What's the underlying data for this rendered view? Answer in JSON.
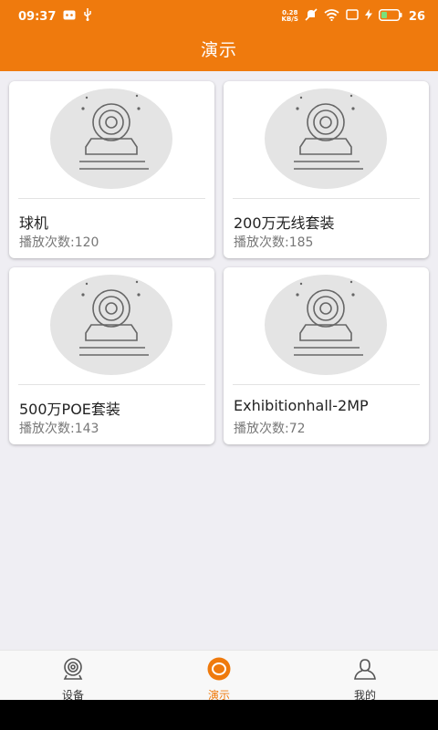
{
  "status_bar": {
    "time": "09:37",
    "net_speed_value": "0.28",
    "net_speed_unit": "KB/S",
    "battery": "26"
  },
  "header": {
    "title": "演示"
  },
  "cards": [
    {
      "title": "球机",
      "play_count": "播放次数:120"
    },
    {
      "title": "200万无线套装",
      "play_count": "播放次数:185"
    },
    {
      "title": "500万POE套装",
      "play_count": "播放次数:143"
    },
    {
      "title": "Exhibitionhall-2MP",
      "play_count": "播放次数:72"
    }
  ],
  "tabbar": {
    "tabs": [
      {
        "label": "设备",
        "icon": "camera-icon"
      },
      {
        "label": "演示",
        "icon": "play-circle-icon"
      },
      {
        "label": "我的",
        "icon": "user-icon"
      }
    ],
    "active_index": 1,
    "active_color": "#ef7a0d"
  },
  "colors": {
    "brand": "#ef7a0d",
    "background": "#efeef3"
  }
}
